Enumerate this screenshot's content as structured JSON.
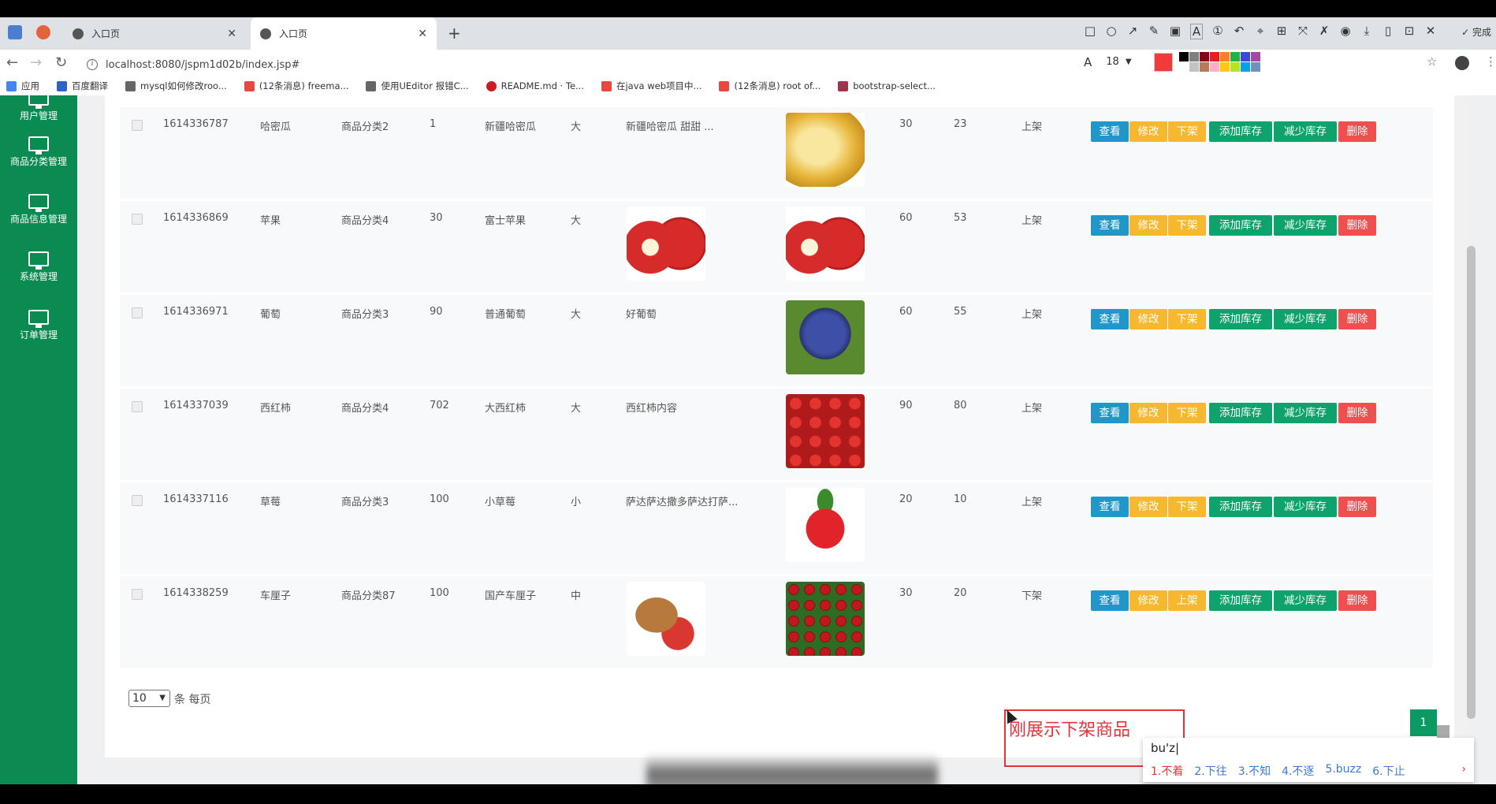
{
  "browser": {
    "tabs": [
      {
        "title": "入口页",
        "active": false
      },
      {
        "title": "入口页",
        "active": true
      }
    ],
    "url": "localhost:8080/jspm1d02b/index.jsp#",
    "bookmarks": [
      {
        "label": "应用",
        "icon": "apps-icon",
        "color": "#4285f4"
      },
      {
        "label": "百度翻译",
        "icon": "baidu-translate-icon",
        "color": "#2b63c9"
      },
      {
        "label": "mysql如何修改roo...",
        "icon": "link-icon",
        "color": "#666666"
      },
      {
        "label": "(12条消息) freema...",
        "icon": "csdn-icon",
        "color": "#e8483f"
      },
      {
        "label": "使用UEditor 报错C...",
        "icon": "link-icon",
        "color": "#666666"
      },
      {
        "label": "README.md · Te...",
        "icon": "gitee-icon",
        "color": "#c71d23"
      },
      {
        "label": "在java web项目中...",
        "icon": "csdn-icon",
        "color": "#e8483f"
      },
      {
        "label": "(12条消息) root of...",
        "icon": "csdn-icon",
        "color": "#e8483f"
      },
      {
        "label": "bootstrap-select...",
        "icon": "page-icon",
        "color": "#a0344b"
      }
    ]
  },
  "screenshot_tool": {
    "font_size": "18",
    "done_label": "完成",
    "current_color": "#f23a3a",
    "palette": [
      "#000000",
      "#7f7f7f",
      "#880015",
      "#ed1c24",
      "#ff7f27",
      "#22b14c",
      "#3f48cc",
      "#a349a4",
      "#ffffff",
      "#c3c3c3",
      "#b97a57",
      "#ffaec9",
      "#ffc90e",
      "#b5e61d",
      "#00a2e8",
      "#7092be"
    ]
  },
  "sidebar": {
    "items": [
      {
        "label": "用户管理"
      },
      {
        "label": "商品分类管理"
      },
      {
        "label": "商品信息管理"
      },
      {
        "label": "系统管理"
      },
      {
        "label": "订单管理"
      }
    ]
  },
  "table": {
    "rows": [
      {
        "id": "1614336787",
        "name": "哈密瓜",
        "category": "商品分类2",
        "price": "1",
        "title": "新疆哈密瓜",
        "size": "大",
        "desc": "新疆哈密瓜 甜甜 ...",
        "image1": null,
        "image2": "melon",
        "stock_total": "30",
        "stock_left": "23",
        "status": "上架",
        "shelf_action": "下架"
      },
      {
        "id": "1614336869",
        "name": "苹果",
        "category": "商品分类4",
        "price": "30",
        "title": "富士苹果",
        "size": "大",
        "desc": "",
        "image1": "apple",
        "image2": "apple",
        "stock_total": "60",
        "stock_left": "53",
        "status": "上架",
        "shelf_action": "下架"
      },
      {
        "id": "1614336971",
        "name": "葡萄",
        "category": "商品分类3",
        "price": "90",
        "title": "普通葡萄",
        "size": "大",
        "desc": "好葡萄",
        "image1": null,
        "image2": "grape",
        "stock_total": "60",
        "stock_left": "55",
        "status": "上架",
        "shelf_action": "下架"
      },
      {
        "id": "1614337039",
        "name": "西红柿",
        "category": "商品分类4",
        "price": "702",
        "title": "大西红柿",
        "size": "大",
        "desc": "西红柿内容",
        "image1": null,
        "image2": "tomato",
        "stock_total": "90",
        "stock_left": "80",
        "status": "上架",
        "shelf_action": "下架"
      },
      {
        "id": "1614337116",
        "name": "草莓",
        "category": "商品分类3",
        "price": "100",
        "title": "小草莓",
        "size": "小",
        "desc": "萨达萨达撒多萨达打萨...",
        "image1": null,
        "image2": "strawberry",
        "stock_total": "20",
        "stock_left": "10",
        "status": "上架",
        "shelf_action": "下架"
      },
      {
        "id": "1614338259",
        "name": "车厘子",
        "category": "商品分类87",
        "price": "100",
        "title": "国产车厘子",
        "size": "中",
        "desc": "",
        "image1": "cherrybag",
        "image2": "cherry",
        "stock_total": "30",
        "stock_left": "20",
        "status": "下架",
        "shelf_action": "上架"
      }
    ],
    "actions": {
      "view": "查看",
      "edit": "修改",
      "add_stock": "添加库存",
      "reduce_stock": "减少库存",
      "delete": "删除"
    }
  },
  "pagination": {
    "per_page": "10",
    "per_page_label": "条 每页",
    "current_page": "1"
  },
  "annotation": {
    "text": "刚展示下架商品"
  },
  "ime": {
    "input": "bu'z|",
    "candidates": [
      "1.不着",
      "2.下往",
      "3.不知",
      "4.不逐",
      "5.buzz",
      "6.下止"
    ]
  }
}
